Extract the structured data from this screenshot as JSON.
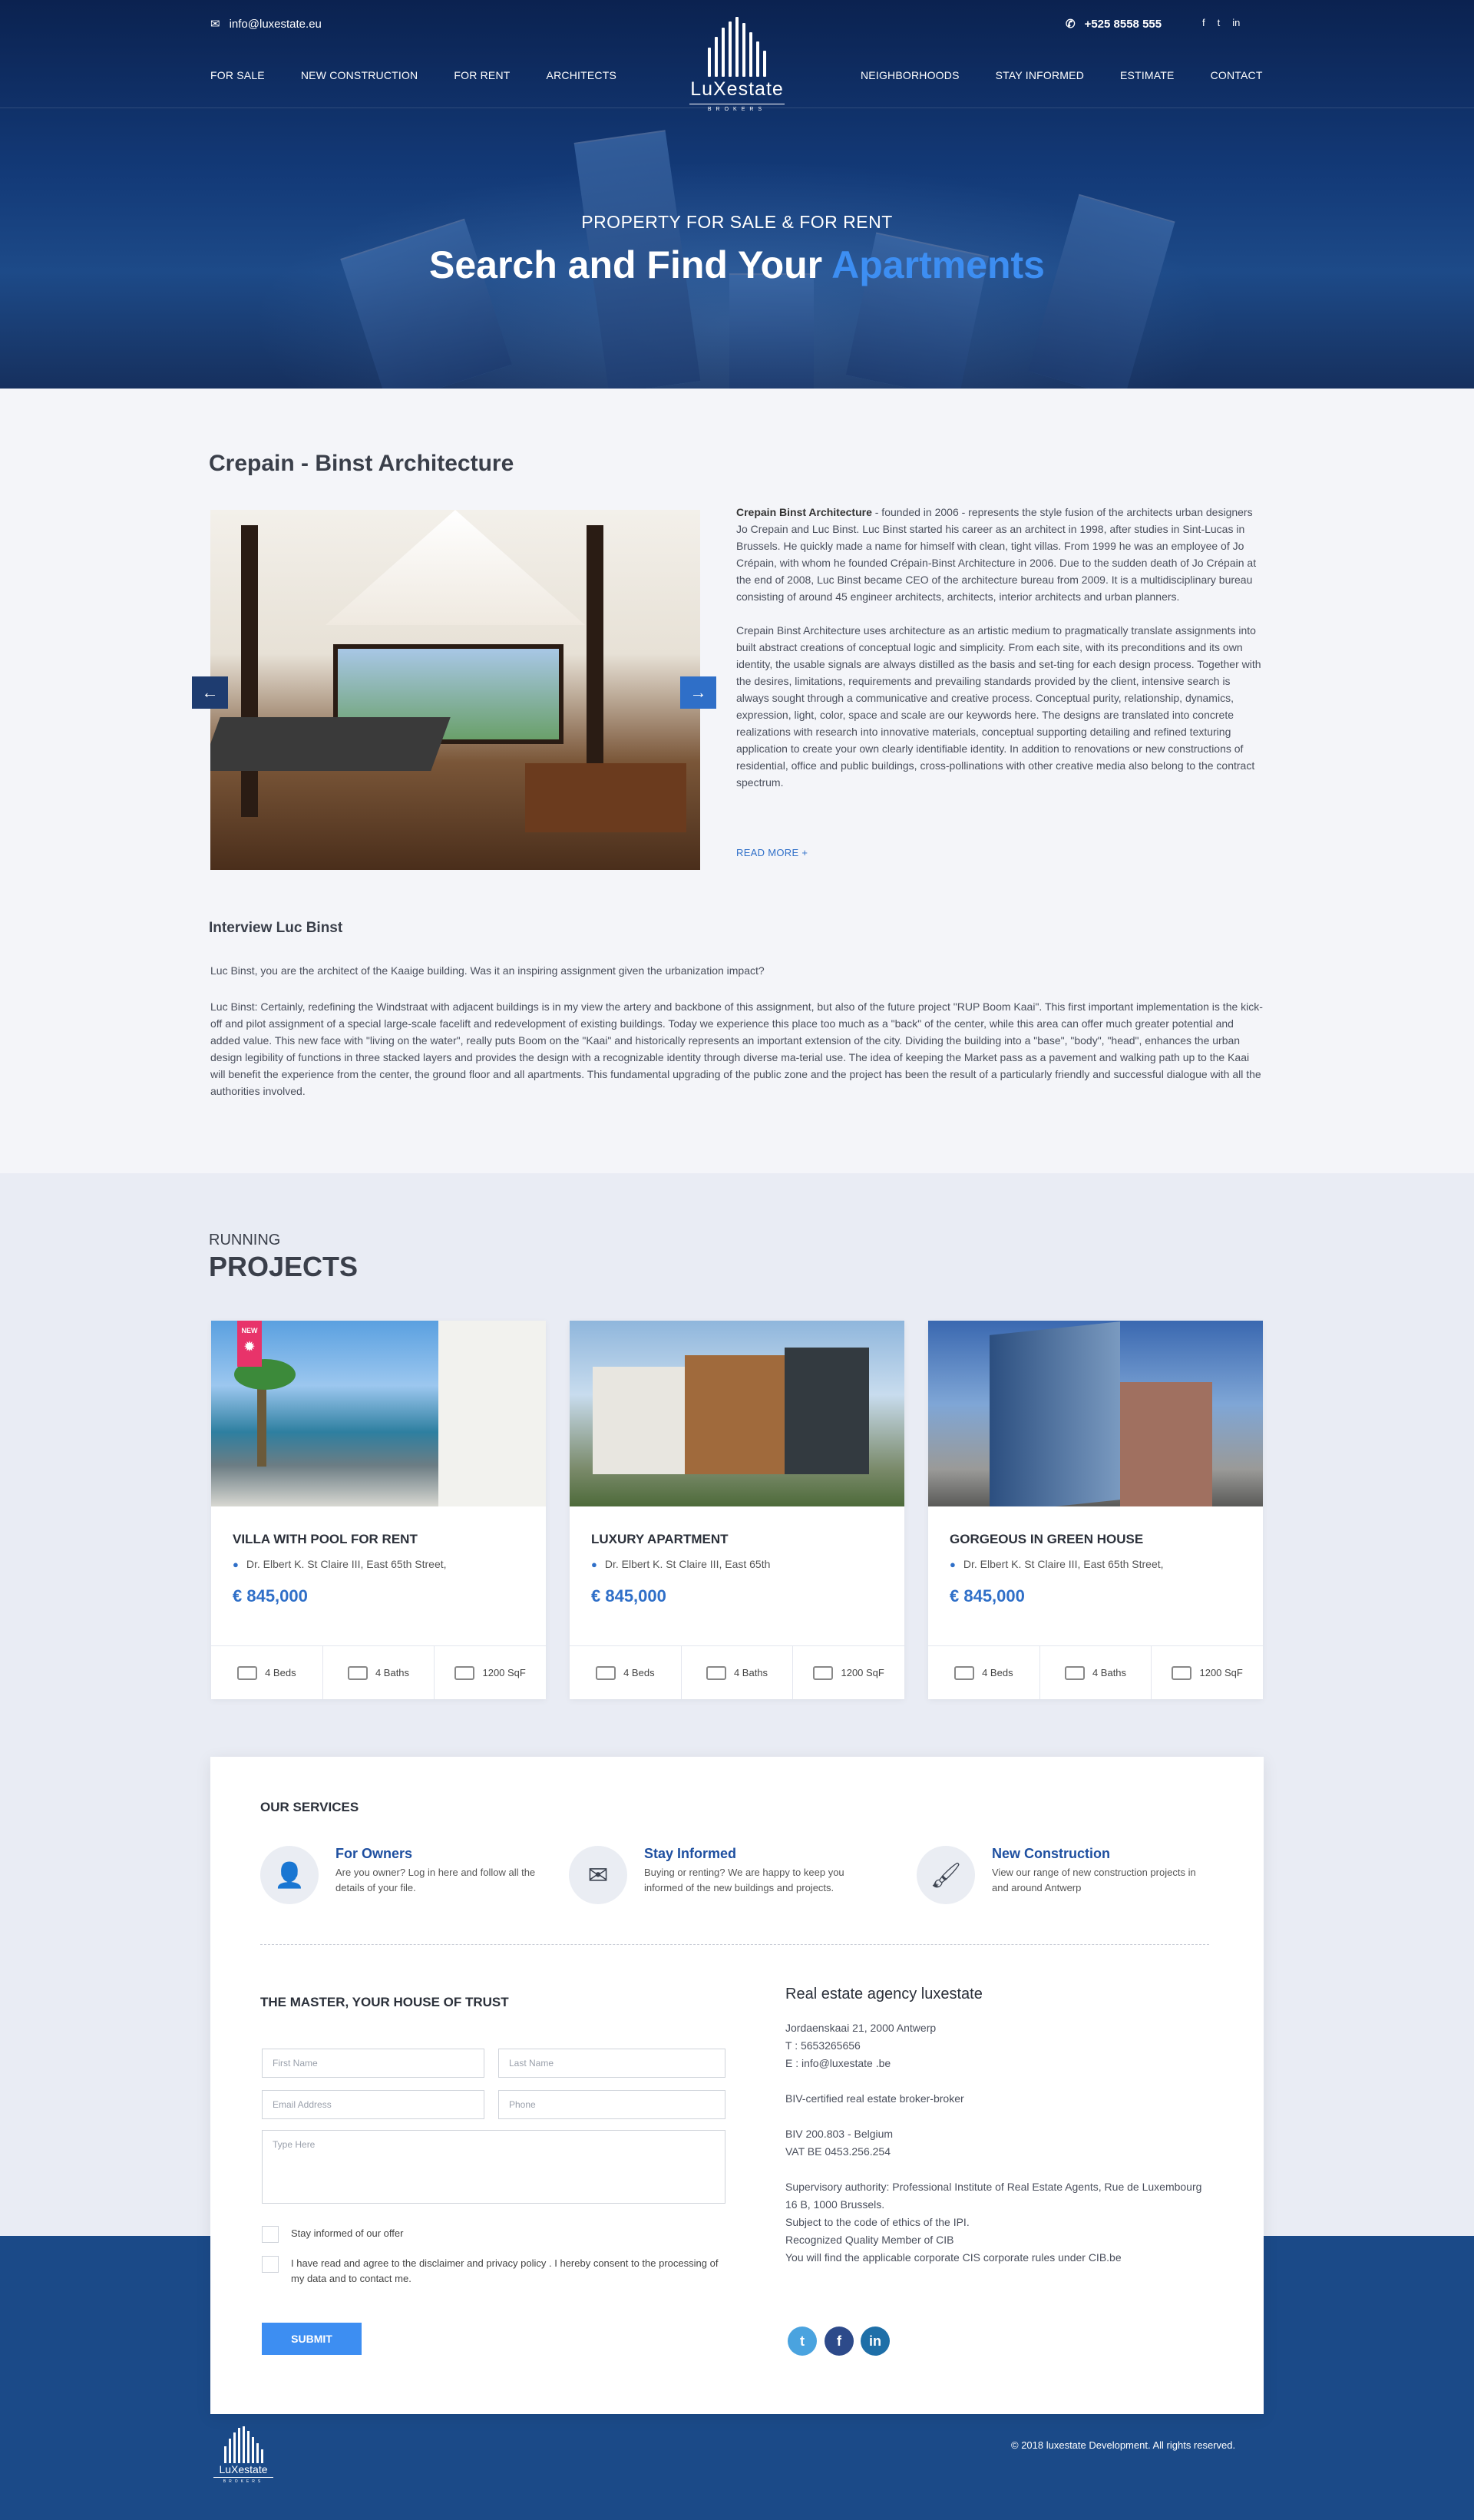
{
  "header": {
    "email": "info@luxestate.eu",
    "phone": "+525 8558 555",
    "social": [
      "f",
      "t",
      "in"
    ],
    "nav_left": [
      "FOR SALE",
      "NEW CONSTRUCTION",
      "FOR RENT",
      "ARCHITECTS"
    ],
    "nav_right": [
      "NEIGHBORHOODS",
      "STAY INFORMED",
      "ESTIMATE",
      "CONTACT"
    ],
    "logo_name": "LuXestate",
    "logo_sub": "BROKERS"
  },
  "hero": {
    "subtitle": "PROPERTY FOR SALE & FOR RENT",
    "title_main": "Search and Find Your ",
    "title_accent": "Apartments"
  },
  "architect": {
    "title": "Crepain - Binst Architecture",
    "p1_bold": "Crepain Binst Architecture",
    "p1": " - founded in 2006 - represents the style fusion of the architects urban designers Jo Crepain and Luc Binst. Luc Binst started his career as an architect in 1998, after studies in Sint-Lucas in Brussels. He quickly made a name for himself with clean, tight villas. From 1999 he was an employee of Jo Crépain, with whom he founded Crépain-Binst Architecture in 2006. Due to the sudden death of Jo Crépain at the end of 2008, Luc Binst became CEO of the architecture bureau from 2009. It is a multidisciplinary bureau consisting of around 45 engineer architects, architects, interior architects and urban planners.",
    "p2": "Crepain Binst Architecture uses architecture as an artistic medium to pragmatically translate assignments into built abstract creations of conceptual logic and simplicity. From each site, with its preconditions and its own identity, the usable signals are always distilled as the basis and set-ting for each design process. Together with the desires, limitations, requirements and prevailing standards provided by the client, intensive search is always sought through a communicative and creative process. Conceptual purity, relationship, dynamics, expression, light, color, space and scale are our keywords here. The designs are translated into concrete realizations with research into innovative materials, conceptual supporting detailing and refined texturing application to create your own clearly identifiable identity. In addition to renovations or new constructions of residential, office and public buildings, cross-pollinations with other creative media also belong to the contract spectrum.",
    "read_more": "READ MORE +",
    "interview_title": "Interview Luc Binst",
    "interview_q": "Luc Binst, you are the architect of the Kaaige building. Was it an inspiring assignment given the urbanization impact?",
    "interview_a": "Luc Binst: Certainly, redefining the Windstraat with adjacent buildings is in my view the artery and backbone of this assignment, but also of the future project \"RUP Boom Kaai\". This first important implementation is the kick-off and pilot assignment of a special large-scale facelift and redevelopment of existing buildings. Today we experience this place too much as a \"back\" of the center, while this area can offer much greater potential and added value. This new face with \"living on the water\", really puts Boom on the \"Kaai\" and historically represents an important extension of the city. Dividing the building into a \"base\", \"body\", \"head\", enhances the urban design legibility of functions in three stacked layers and provides the design with a recognizable identity through diverse ma-terial use. The idea of keeping the Market pass as a pavement and walking path up to the Kaai will benefit the experience from the center, the ground floor and all apartments. This fundamental upgrading of the public zone and the project has been the result of a particularly friendly and successful dialogue with all the authorities involved."
  },
  "projects": {
    "kicker": "RUNNING",
    "title": "PROJECTS",
    "new_badge": "NEW",
    "cards": [
      {
        "title": "VILLA WITH POOL FOR RENT",
        "address": "Dr. Elbert K. St Claire III, East 65th Street,",
        "price": "€ 845,000",
        "beds": "4 Beds",
        "baths": "4 Baths",
        "area": "1200 SqF"
      },
      {
        "title": "LUXURY APARTMENT",
        "address": "Dr. Elbert K. St Claire III, East 65th",
        "price": "€ 845,000",
        "beds": "4 Beds",
        "baths": "4 Baths",
        "area": "1200 SqF"
      },
      {
        "title": "GORGEOUS IN GREEN HOUSE",
        "address": "Dr. Elbert K. St Claire III, East 65th Street,",
        "price": "€ 845,000",
        "beds": "4 Beds",
        "baths": "4 Baths",
        "area": "1200 SqF"
      }
    ]
  },
  "services": {
    "title": "OUR SERVICES",
    "items": [
      {
        "title": "For Owners",
        "desc": "Are you owner? Log in here and follow all the details of your file."
      },
      {
        "title": "Stay Informed",
        "desc": "Buying or renting? We are happy to keep you informed of the new buildings and projects."
      },
      {
        "title": "New Construction",
        "desc": "View our range of new construction projects in and around Antwerp"
      }
    ]
  },
  "form": {
    "title": "THE MASTER, YOUR HOUSE OF TRUST",
    "first_name": "First Name",
    "last_name": "Last Name",
    "email": "Email Address",
    "phone": "Phone",
    "message": "Type Here",
    "check1": "Stay informed of our offer",
    "check2": "I have read and agree to the disclaimer and privacy policy . I hereby consent to the processing of my data and to contact me.",
    "submit": "SUBMIT"
  },
  "agency": {
    "title": "Real estate agency luxestate",
    "address": "Jordaenskaai 21, 2000 Antwerp",
    "tel": "T : 5653265656",
    "mail": "E : info@luxestate .be",
    "certified": "BIV-certified real estate broker-broker",
    "biv": "BIV 200.803 - Belgium",
    "vat": "VAT BE 0453.256.254",
    "supervisory": "Supervisory authority: Professional Institute of Real Estate Agents, Rue de Luxembourg 16 B, 1000 Brussels.",
    "code": "Subject to the code of ethics of the IPI.",
    "member": "Recognized Quality Member of CIB",
    "rules": "You will find the applicable corporate CIS corporate rules under CIB.be"
  },
  "footer": {
    "copyright": "© 2018 luxestate Development. All rights reserved."
  },
  "colors": {
    "primary": "#1b4a88",
    "accent": "#3d8ef2",
    "badge": "#e8336a"
  }
}
